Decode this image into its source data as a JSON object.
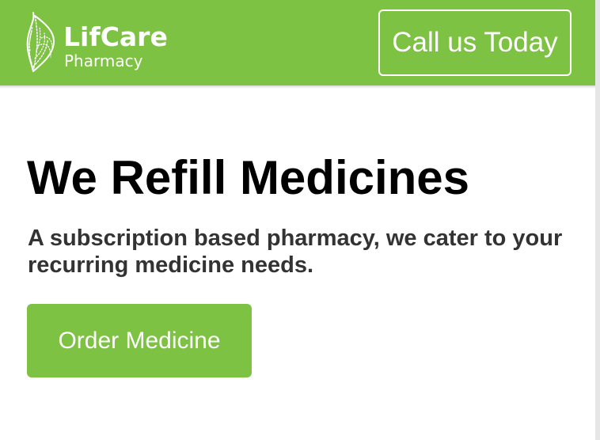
{
  "header": {
    "logo": {
      "name": "LifCare",
      "subtitle": "Pharmacy",
      "icon": "leaf-icon"
    },
    "call_button_label": "Call us Today"
  },
  "hero": {
    "title": "We Refill Medicines",
    "subtitle": "A subscription based pharmacy, we cater to your recurring medicine needs.",
    "cta_label": "Order Medicine"
  },
  "colors": {
    "brand_green": "#7dc243",
    "text_dark": "#000000",
    "text_subtitle": "#333333",
    "background": "#ffffff"
  }
}
